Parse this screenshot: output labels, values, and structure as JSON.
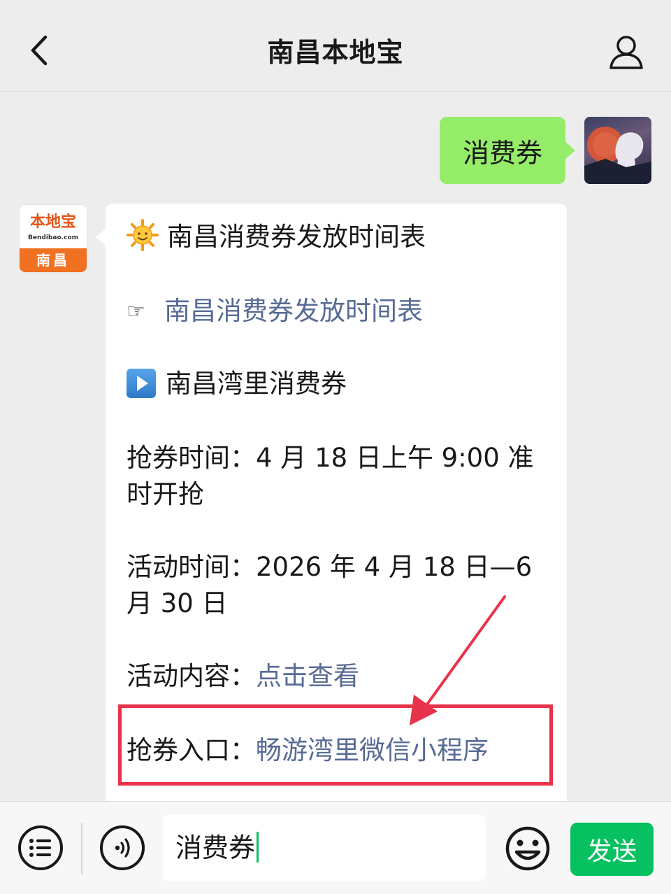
{
  "header": {
    "title": "南昌本地宝"
  },
  "chat": {
    "outgoing": {
      "text": "消费券"
    },
    "bot": {
      "avatar": {
        "logo_text": "本地宝",
        "logo_sub": "Bendibao.com",
        "city": "南昌"
      },
      "lines": {
        "heading": "南昌消费券发放时间表",
        "link_schedule": "南昌消费券发放时间表",
        "section": "南昌湾里消费券",
        "grab_time_label": "抢券时间：",
        "grab_time_value": "4 月 18 日上午 9:00 准时开抢",
        "activity_time_label": "活动时间：",
        "activity_time_value": "2026 年 4 月 18 日—6 月 30 日",
        "activity_content_label": "活动内容：",
        "activity_content_link": "点击查看",
        "entry_label": "抢券入口：",
        "entry_link": "畅游湾里微信小程序"
      }
    },
    "annotation_color": "#e8334a"
  },
  "composer": {
    "input_value": "消费券",
    "send_label": "发送"
  },
  "colors": {
    "accent": "#07c160",
    "my_bubble": "#95ec69",
    "link": "#576b95"
  },
  "icons": [
    "back-arrow-icon",
    "user-icon",
    "sun-emoji-icon",
    "pointing-hand-icon",
    "play-button-icon",
    "list-menu-icon",
    "voice-icon",
    "emoji-icon"
  ]
}
